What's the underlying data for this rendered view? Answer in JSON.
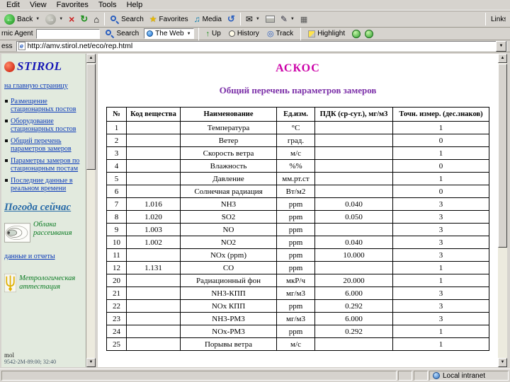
{
  "colors": {
    "title": "#cc00a8",
    "subtitle": "#7b2fa8",
    "link": "#0a3ab8",
    "caption_green": "#0a7a22",
    "chrome": "#d6d3ce"
  },
  "browser": {
    "menu_items": [
      "Edit",
      "View",
      "Favorites",
      "Tools",
      "Help"
    ],
    "toolbar": {
      "back": "Back",
      "search": "Search",
      "favorites": "Favorites",
      "media": "Media",
      "links": "Links"
    },
    "agent_bar": {
      "label": "rnic Agent",
      "search_value": "",
      "search_button": "Search",
      "engine": "The Web",
      "up": "Up",
      "history": "History",
      "track": "Track",
      "highlight": "Highlight"
    },
    "address": {
      "label": "ess",
      "url": "http://amv.stirol.net/eco/rep.html"
    },
    "status": {
      "zone": "Local intranet"
    }
  },
  "sidebar": {
    "logo_text": "STIROL",
    "home_link": "на главную страницу",
    "nav_links": [
      "Размещение стационарных постов",
      "Оборудование стационарных постов",
      "Общий перечень параметров замеров",
      "Параметры замеров по стационарным постам",
      "Последние данные в реальном времени"
    ],
    "weather_link": "Погода  сейчас",
    "clouds_caption": "Облака рассеивания",
    "reports_link": "данные и отчеты",
    "metrology_caption": "Метрологическая аттестация",
    "footer_note": "mol",
    "counter_text": "9542-2M-89:00; 32:40"
  },
  "main": {
    "title": "АСКОС",
    "subtitle": "Общий перечень параметров замеров",
    "table": {
      "headers": [
        "№",
        "Код вещества",
        "Наименование",
        "Ед.изм.",
        "ПДК (ср-сут.), мг/м3",
        "Точн. измер. (дес.знаков)"
      ],
      "rows": [
        [
          "1",
          "",
          "Температура",
          "°C",
          "",
          "1"
        ],
        [
          "2",
          "",
          "Ветер",
          "град.",
          "",
          "0"
        ],
        [
          "3",
          "",
          "Скорость ветра",
          "м/с",
          "",
          "1"
        ],
        [
          "4",
          "",
          "Влажность",
          "%%",
          "",
          "0"
        ],
        [
          "5",
          "",
          "Давление",
          "мм.рт.ст",
          "",
          "1"
        ],
        [
          "6",
          "",
          "Солнечная радиация",
          "Вт/м2",
          "",
          "0"
        ],
        [
          "7",
          "1.016",
          "NH3",
          "ppm",
          "0.040",
          "3"
        ],
        [
          "8",
          "1.020",
          "SO2",
          "ppm",
          "0.050",
          "3"
        ],
        [
          "9",
          "1.003",
          "NO",
          "ppm",
          "",
          "3"
        ],
        [
          "10",
          "1.002",
          "NO2",
          "ppm",
          "0.040",
          "3"
        ],
        [
          "11",
          "",
          "NOx (ppm)",
          "ppm",
          "10.000",
          "3"
        ],
        [
          "12",
          "1.131",
          "CO",
          "ppm",
          "",
          "1"
        ],
        [
          "20",
          "",
          "Радиационный фон",
          "мкР/ч",
          "20.000",
          "1"
        ],
        [
          "21",
          "",
          "NH3-КПП",
          "мг/м3",
          "6.000",
          "3"
        ],
        [
          "22",
          "",
          "NOx КПП",
          "ppm",
          "0.292",
          "3"
        ],
        [
          "23",
          "",
          "NH3-РМ3",
          "мг/м3",
          "6.000",
          "3"
        ],
        [
          "24",
          "",
          "NOx-РМ3",
          "ppm",
          "0.292",
          "1"
        ],
        [
          "25",
          "",
          "Порывы ветра",
          "м/с",
          "",
          "1"
        ]
      ]
    }
  }
}
